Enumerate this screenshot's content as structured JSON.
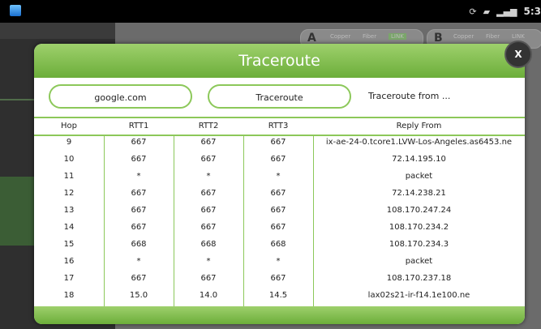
{
  "status_bar": {
    "clock": "5:3",
    "icons": [
      "sync-icon",
      "sd-card-icon",
      "signal-icon"
    ]
  },
  "background": {
    "ports": [
      {
        "letter": "A",
        "labels": [
          "Copper",
          "Fiber",
          "LINK"
        ]
      },
      {
        "letter": "B",
        "labels": [
          "Copper",
          "Fiber",
          "LINK"
        ]
      }
    ]
  },
  "dialog": {
    "title": "Traceroute",
    "close_label": "X",
    "host_input_value": "google.com",
    "traceroute_button": "Traceroute",
    "traceroute_from": "Traceroute from ...",
    "columns": [
      "Hop",
      "RTT1",
      "RTT2",
      "RTT3",
      "Reply From"
    ],
    "rows": [
      {
        "hop": "9",
        "rtt1": "667",
        "rtt2": "667",
        "rtt3": "667",
        "reply": "ix-ae-24-0.tcore1.LVW-Los-Angeles.as6453.ne"
      },
      {
        "hop": "10",
        "rtt1": "667",
        "rtt2": "667",
        "rtt3": "667",
        "reply": "72.14.195.10"
      },
      {
        "hop": "11",
        "rtt1": "*",
        "rtt2": "*",
        "rtt3": "*",
        "reply": "packet"
      },
      {
        "hop": "12",
        "rtt1": "667",
        "rtt2": "667",
        "rtt3": "667",
        "reply": "72.14.238.21"
      },
      {
        "hop": "13",
        "rtt1": "667",
        "rtt2": "667",
        "rtt3": "667",
        "reply": "108.170.247.24"
      },
      {
        "hop": "14",
        "rtt1": "667",
        "rtt2": "667",
        "rtt3": "667",
        "reply": "108.170.234.2"
      },
      {
        "hop": "15",
        "rtt1": "668",
        "rtt2": "668",
        "rtt3": "668",
        "reply": "108.170.234.3"
      },
      {
        "hop": "16",
        "rtt1": "*",
        "rtt2": "*",
        "rtt3": "*",
        "reply": "packet"
      },
      {
        "hop": "17",
        "rtt1": "667",
        "rtt2": "667",
        "rtt3": "667",
        "reply": "108.170.237.18"
      },
      {
        "hop": "18",
        "rtt1": "15.0",
        "rtt2": "14.0",
        "rtt3": "14.5",
        "reply": "lax02s21-ir-f14.1e100.ne"
      }
    ]
  },
  "colors": {
    "accent_green": "#8cc85a",
    "header_green_top": "#9ed06c",
    "header_green_bottom": "#6cae3a"
  }
}
